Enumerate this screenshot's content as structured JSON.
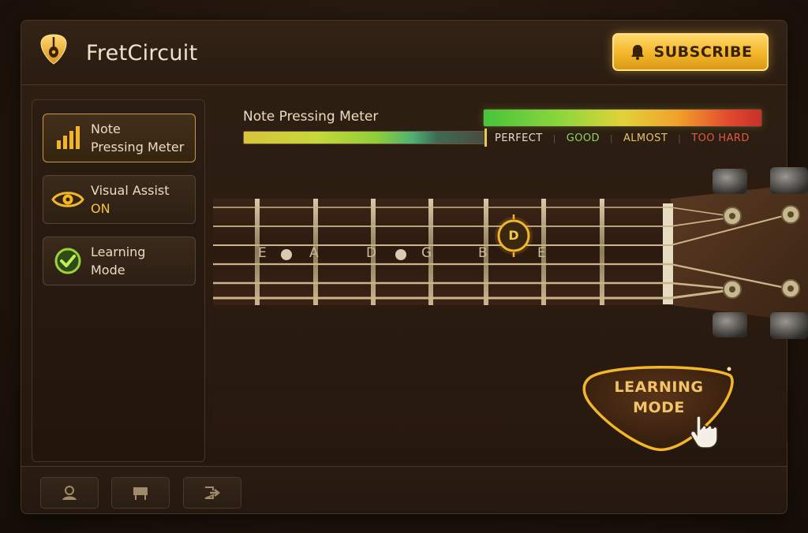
{
  "header": {
    "brand": "FretCircuit",
    "subscribe_label": "SUBSCRIBE"
  },
  "sidebar": {
    "items": [
      {
        "label_line1": "Note",
        "label_line2": "Pressing Meter",
        "icon": "bar-chart-icon",
        "active": true
      },
      {
        "label_line1": "Visual Assist",
        "label_line2": "ON",
        "icon": "eye-icon",
        "active": false
      },
      {
        "label_line1": "Learning",
        "label_line2": "Mode",
        "icon": "check-circle-icon",
        "active": false
      }
    ]
  },
  "meter": {
    "title": "Note Pressing Meter",
    "level": 0.995,
    "scale_labels": {
      "perfect": "PERFECT",
      "good": "GOOD",
      "almost": "ALMOST",
      "too_hard": "TOO HARD"
    }
  },
  "fretboard": {
    "string_names": [
      "E",
      "A",
      "D",
      "G",
      "B",
      "E"
    ],
    "target_note": "D"
  },
  "learning_mode_button": {
    "line1": "LEARNING",
    "line2": "MODE"
  },
  "toolbar": {
    "icons": [
      "profile-icon",
      "chord-icon",
      "exit-icon"
    ]
  },
  "colors": {
    "accent_gold": "#f2b628",
    "background": "#24170e",
    "good": "#8fd36a",
    "too_hard": "#e05a44"
  }
}
